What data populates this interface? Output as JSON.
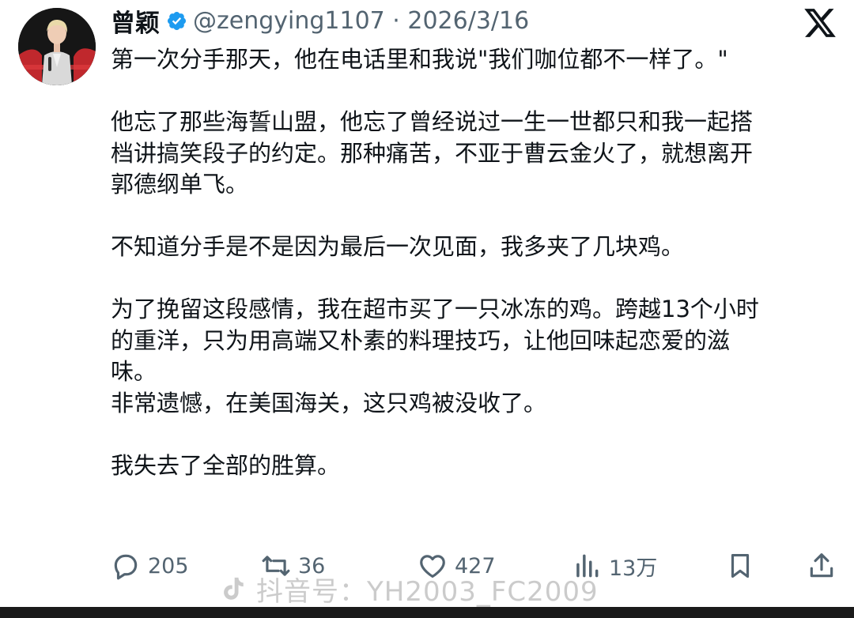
{
  "author": {
    "name": "曾颖",
    "handle_date": "@zengying1107 · 2026/3/16",
    "verified_icon": "verified-badge-icon",
    "avatar": "presenter-on-stage-photo"
  },
  "platform_logo": "x-logo-icon",
  "post": {
    "lines": [
      "第一次分手那天，他在电话里和我说\"我们咖位都不一样了。\"",
      "",
      "他忘了那些海誓山盟，他忘了曾经说过一生一世都只和我一起搭",
      "档讲搞笑段子的约定。那种痛苦，不亚于曹云金火了，就想离开",
      "郭德纲单飞。",
      "",
      "不知道分手是不是因为最后一次见面，我多夹了几块鸡。",
      "",
      "为了挽留这段感情，我在超市买了一只冰冻的鸡。跨越13个小时",
      "的重洋，只为用高端又朴素的料理技巧，让他回味起恋爱的滋",
      "味。",
      "非常遗憾，在美国海关，这只鸡被没收了。",
      "",
      "我失去了全部的胜算。"
    ]
  },
  "actions": {
    "reply": {
      "icon": "reply-icon",
      "count": "205"
    },
    "retweet": {
      "icon": "retweet-icon",
      "count": "36"
    },
    "like": {
      "icon": "heart-icon",
      "count": "427"
    },
    "views": {
      "icon": "views-icon",
      "count": "13万"
    },
    "bookmark": {
      "icon": "bookmark-icon"
    },
    "share": {
      "icon": "share-icon"
    }
  },
  "watermark": {
    "text": "抖音号：YH2003_FC2009",
    "icon": "douyin-icon"
  },
  "colors": {
    "text": "#0f1419",
    "secondary": "#536471",
    "verified": "#1d9bf0"
  }
}
